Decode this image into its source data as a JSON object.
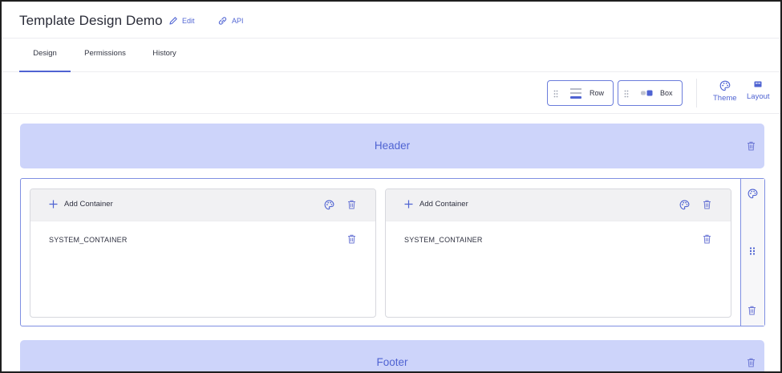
{
  "header": {
    "title": "Template Design Demo",
    "edit_label": "Edit",
    "api_label": "API"
  },
  "tabs": [
    {
      "label": "Design",
      "active": true
    },
    {
      "label": "Permissions",
      "active": false
    },
    {
      "label": "History",
      "active": false
    }
  ],
  "toolbar": {
    "row_label": "Row",
    "box_label": "Box",
    "theme_label": "Theme",
    "layout_label": "Layout"
  },
  "canvas": {
    "header_label": "Header",
    "footer_label": "Footer",
    "containers": [
      {
        "add_label": "Add Container",
        "item_label": "SYSTEM_CONTAINER"
      },
      {
        "add_label": "Add Container",
        "item_label": "SYSTEM_CONTAINER"
      }
    ]
  },
  "colors": {
    "accent": "#4f63d2",
    "band_fill": "#cdd4fa",
    "card_header": "#f1f1f3",
    "border": "#7f8fe2"
  },
  "icons": {
    "edit": "pencil-icon",
    "api": "link-icon",
    "drag": "drag-handle-icon",
    "row": "row-icon",
    "box": "box-icon",
    "theme": "palette-icon",
    "layout": "layout-icon",
    "trash": "trash-icon",
    "add": "plus-icon"
  }
}
